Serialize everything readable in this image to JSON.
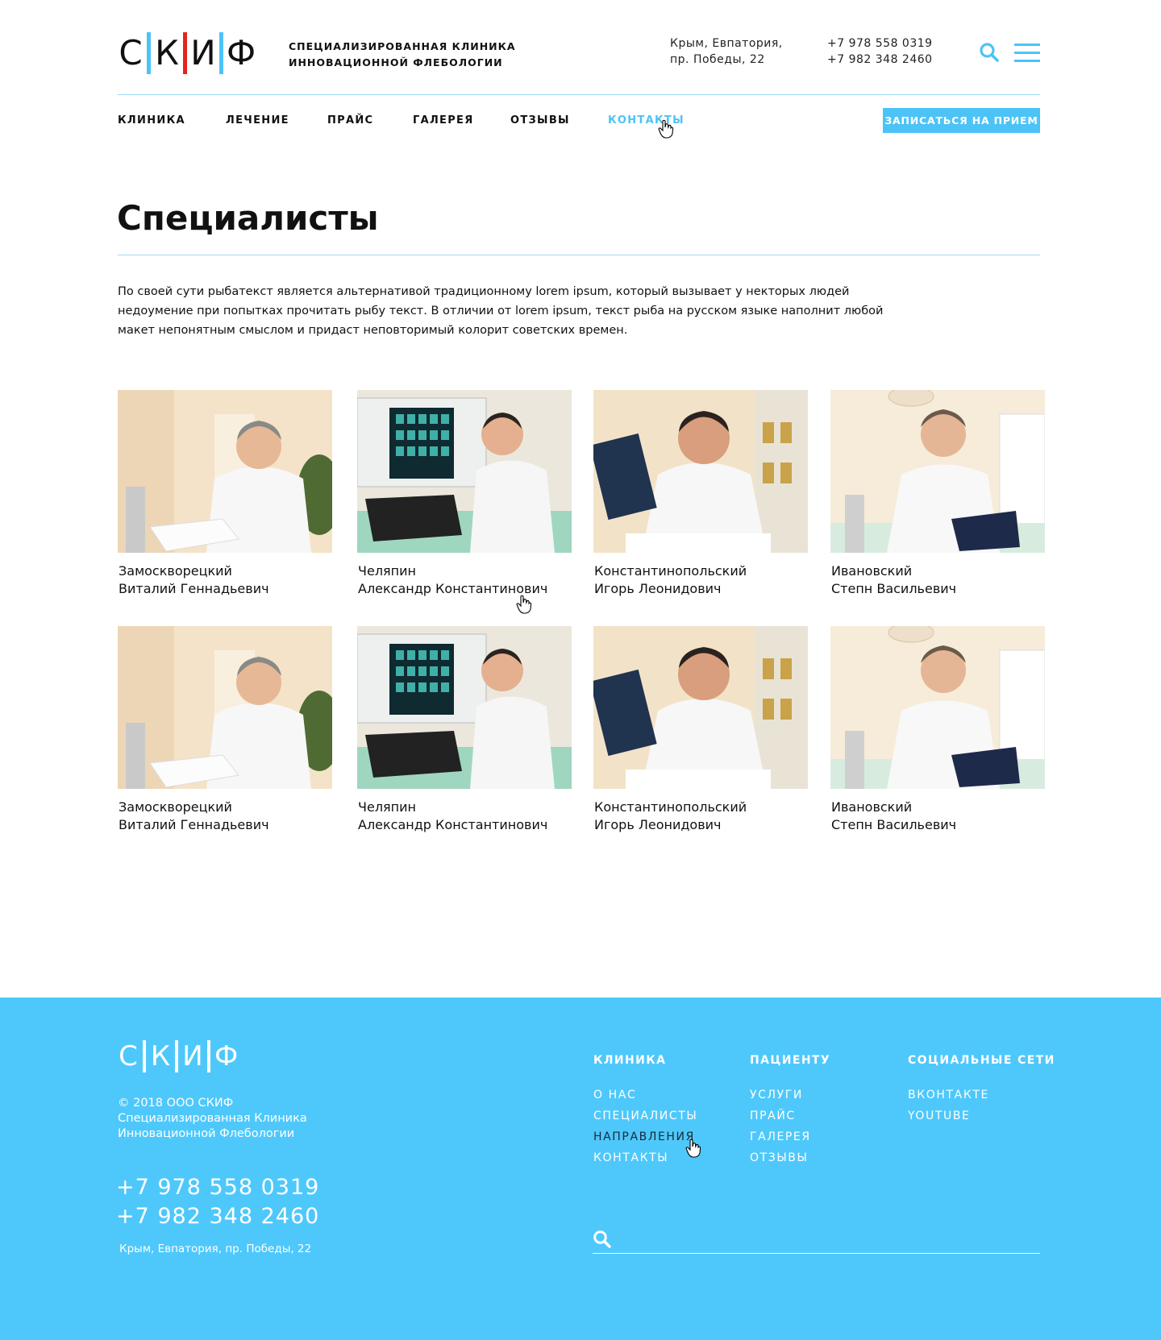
{
  "header": {
    "logo_letters": [
      "С",
      "К",
      "И",
      "Ф"
    ],
    "logo_subtitle_1": "СПЕЦИАЛИЗИРОВАННАЯ КЛИНИКА",
    "logo_subtitle_2": "ИННОВАЦИОННОЙ ФЛЕБОЛОГИИ",
    "address_1": "Крым, Евпатория,",
    "address_2": "пр. Победы, 22",
    "phone_1": "+7 978 558 0319",
    "phone_2": "+7 982 348 2460",
    "search_icon": "search-icon",
    "menu_icon": "hamburger-menu-icon"
  },
  "nav": {
    "items": [
      {
        "label": "КЛИНИКА"
      },
      {
        "label": "ЛЕЧЕНИЕ"
      },
      {
        "label": "ПРАЙС"
      },
      {
        "label": "ГАЛЕРЕЯ"
      },
      {
        "label": "ОТЗЫВЫ"
      },
      {
        "label": "КОНТАКТЫ",
        "active": true
      }
    ],
    "appointment_button": "ЗАПИСАТЬСЯ НА ПРИЕМ"
  },
  "main": {
    "title": "Специалисты",
    "intro": "По своей сути рыбатекст является альтернативой традиционному lorem ipsum, который вызывает у некторых людей недоумение при попытках прочитать рыбу текст. В отличии от lorem ipsum, текст рыба на русском языке наполнит любой макет непонятным смыслом и придаст неповторимый колорит советских времен.",
    "specialists": [
      {
        "surname": "Замоскворецкий",
        "name": "Виталий Геннадьевич"
      },
      {
        "surname": "Челяпин",
        "name": "Александр Константинович"
      },
      {
        "surname": "Константинопольский",
        "name": "Игорь Леонидович"
      },
      {
        "surname": "Ивановский",
        "name": "Степн Васильевич"
      },
      {
        "surname": "Замоскворецкий",
        "name": "Виталий Геннадьевич"
      },
      {
        "surname": "Челяпин",
        "name": "Александр Константинович"
      },
      {
        "surname": "Константинопольский",
        "name": "Игорь Леонидович"
      },
      {
        "surname": "Ивановский",
        "name": "Степн Васильевич"
      }
    ]
  },
  "footer": {
    "logo_letters": [
      "С",
      "К",
      "И",
      "Ф"
    ],
    "copyright": "© 2018 ООО СКИФ",
    "company_1": "Специализированная Клиника",
    "company_2": "Инновационной Флебологии",
    "phone_1": "+7 978 558 0319",
    "phone_2": "+7 982 348 2460",
    "address": "Крым, Евпатория, пр. Победы, 22",
    "columns": [
      {
        "title": "КЛИНИКА",
        "links": [
          "О НАС",
          "СПЕЦИАЛИСТЫ",
          "НАПРАВЛЕНИЯ",
          "КОНТАКТЫ"
        ]
      },
      {
        "title": "ПАЦИЕНТУ",
        "links": [
          "УСЛУГИ",
          "ПРАЙС",
          "ГАЛЕРЕЯ",
          "ОТЗЫВЫ"
        ]
      },
      {
        "title": "СОЦИАЛЬНЫЕ СЕТИ",
        "links": [
          "ВКОНТАКТЕ",
          "YOUTUBE"
        ]
      }
    ],
    "search_placeholder": ""
  },
  "colors": {
    "accent": "#4cc3f7",
    "logo_red": "#e3261b",
    "footer_bg": "#4ec8fb",
    "text": "#111111"
  }
}
